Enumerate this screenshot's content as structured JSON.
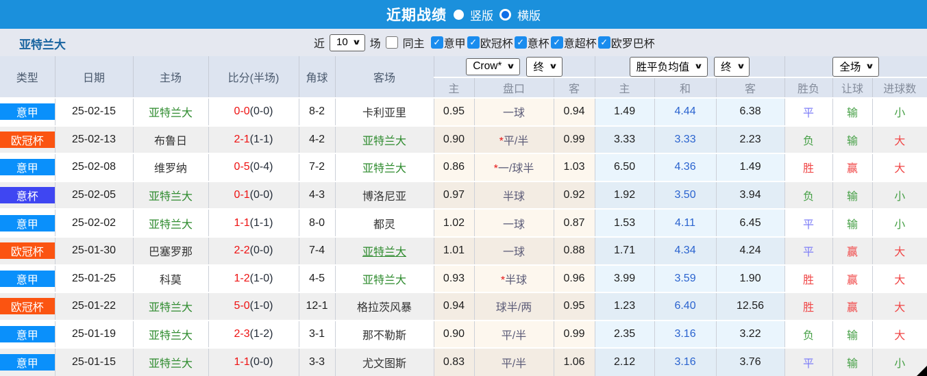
{
  "title_bar": {
    "title": "近期战绩",
    "view_options": [
      {
        "label": "竖版",
        "selected": true
      },
      {
        "label": "横版",
        "selected": false
      }
    ]
  },
  "filter_bar": {
    "team": "亚特兰大",
    "near_label": "近",
    "count_value": "10",
    "unit_label": "场",
    "same_home": {
      "label": "同主",
      "checked": false
    },
    "check_glyph": "✓",
    "leagues": [
      {
        "label": "意甲",
        "checked": true
      },
      {
        "label": "欧冠杯",
        "checked": true
      },
      {
        "label": "意杯",
        "checked": true
      },
      {
        "label": "意超杯",
        "checked": true
      },
      {
        "label": "欧罗巴杯",
        "checked": true
      }
    ]
  },
  "table": {
    "main_headers": [
      "类型",
      "日期",
      "主场",
      "比分(半场)",
      "角球",
      "客场"
    ],
    "dropdowns": {
      "crow": "Crow*",
      "crow_final": "终",
      "avg": "胜平负均值",
      "avg_final": "终",
      "scope": "全场"
    },
    "sub_headers": [
      "主",
      "盘口",
      "客",
      "主",
      "和",
      "客",
      "胜负",
      "让球",
      "进球数"
    ],
    "league_colors": {
      "意甲": "#0a90fb",
      "欧冠杯": "#fb5411",
      "意杯": "#3f46f2"
    },
    "accent_colors": {
      "win_red": "#f04646",
      "draw_blue": "#7d7df7",
      "lose_green": "#47a047",
      "bar_blue": "#1b90dc"
    },
    "rows": [
      {
        "league": "意甲",
        "date": "25-02-15",
        "home": "亚特兰大",
        "home_style": "green",
        "ft": "0-0",
        "ht": "(0-0)",
        "corner": "8-2",
        "away": "卡利亚里",
        "away_style": "dark",
        "away_underline": false,
        "crow_home": "0.95",
        "star": false,
        "handicap": "一球",
        "crow_away": "0.94",
        "avg_home": "1.49",
        "avg_draw": "4.44",
        "avg_away": "6.38",
        "outcome": "平",
        "outcome_cls": "draw",
        "let_outcome": "输",
        "let_cls": "lose",
        "goal_outcome": "小",
        "goal_cls": "lose"
      },
      {
        "league": "欧冠杯",
        "date": "25-02-13",
        "home": "布鲁日",
        "home_style": "dark",
        "ft": "2-1",
        "ht": "(1-1)",
        "corner": "4-2",
        "away": "亚特兰大",
        "away_style": "green",
        "away_underline": false,
        "crow_home": "0.90",
        "star": true,
        "handicap": "平/半",
        "crow_away": "0.99",
        "avg_home": "3.33",
        "avg_draw": "3.33",
        "avg_away": "2.23",
        "outcome": "负",
        "outcome_cls": "lose",
        "let_outcome": "输",
        "let_cls": "lose",
        "goal_outcome": "大",
        "goal_cls": "win"
      },
      {
        "league": "意甲",
        "date": "25-02-08",
        "home": "维罗纳",
        "home_style": "dark",
        "ft": "0-5",
        "ht": "(0-4)",
        "corner": "7-2",
        "away": "亚特兰大",
        "away_style": "green",
        "away_underline": false,
        "crow_home": "0.86",
        "star": true,
        "handicap": "一/球半",
        "crow_away": "1.03",
        "avg_home": "6.50",
        "avg_draw": "4.36",
        "avg_away": "1.49",
        "outcome": "胜",
        "outcome_cls": "win",
        "let_outcome": "赢",
        "let_cls": "win",
        "goal_outcome": "大",
        "goal_cls": "win"
      },
      {
        "league": "意杯",
        "date": "25-02-05",
        "home": "亚特兰大",
        "home_style": "green",
        "ft": "0-1",
        "ht": "(0-0)",
        "corner": "4-3",
        "away": "博洛尼亚",
        "away_style": "dark",
        "away_underline": false,
        "crow_home": "0.97",
        "star": false,
        "handicap": "半球",
        "crow_away": "0.92",
        "avg_home": "1.92",
        "avg_draw": "3.50",
        "avg_away": "3.94",
        "outcome": "负",
        "outcome_cls": "lose",
        "let_outcome": "输",
        "let_cls": "lose",
        "goal_outcome": "小",
        "goal_cls": "lose"
      },
      {
        "league": "意甲",
        "date": "25-02-02",
        "home": "亚特兰大",
        "home_style": "green",
        "ft": "1-1",
        "ht": "(1-1)",
        "corner": "8-0",
        "away": "都灵",
        "away_style": "dark",
        "away_underline": false,
        "crow_home": "1.02",
        "star": false,
        "handicap": "一球",
        "crow_away": "0.87",
        "avg_home": "1.53",
        "avg_draw": "4.11",
        "avg_away": "6.45",
        "outcome": "平",
        "outcome_cls": "draw",
        "let_outcome": "输",
        "let_cls": "lose",
        "goal_outcome": "小",
        "goal_cls": "lose"
      },
      {
        "league": "欧冠杯",
        "date": "25-01-30",
        "home": "巴塞罗那",
        "home_style": "dark",
        "ft": "2-2",
        "ht": "(0-0)",
        "corner": "7-4",
        "away": "亚特兰大",
        "away_style": "green",
        "away_underline": true,
        "crow_home": "1.01",
        "star": false,
        "handicap": "一球",
        "crow_away": "0.88",
        "avg_home": "1.71",
        "avg_draw": "4.34",
        "avg_away": "4.24",
        "outcome": "平",
        "outcome_cls": "draw",
        "let_outcome": "赢",
        "let_cls": "win",
        "goal_outcome": "大",
        "goal_cls": "win"
      },
      {
        "league": "意甲",
        "date": "25-01-25",
        "home": "科莫",
        "home_style": "dark",
        "ft": "1-2",
        "ht": "(1-0)",
        "corner": "4-5",
        "away": "亚特兰大",
        "away_style": "green",
        "away_underline": false,
        "crow_home": "0.93",
        "star": true,
        "handicap": "半球",
        "crow_away": "0.96",
        "avg_home": "3.99",
        "avg_draw": "3.59",
        "avg_away": "1.90",
        "outcome": "胜",
        "outcome_cls": "win",
        "let_outcome": "赢",
        "let_cls": "win",
        "goal_outcome": "大",
        "goal_cls": "win"
      },
      {
        "league": "欧冠杯",
        "date": "25-01-22",
        "home": "亚特兰大",
        "home_style": "green",
        "ft": "5-0",
        "ht": "(1-0)",
        "corner": "12-1",
        "away": "格拉茨风暴",
        "away_style": "dark",
        "away_underline": false,
        "crow_home": "0.94",
        "star": false,
        "handicap": "球半/两",
        "crow_away": "0.95",
        "avg_home": "1.23",
        "avg_draw": "6.40",
        "avg_away": "12.56",
        "outcome": "胜",
        "outcome_cls": "win",
        "let_outcome": "赢",
        "let_cls": "win",
        "goal_outcome": "大",
        "goal_cls": "win"
      },
      {
        "league": "意甲",
        "date": "25-01-19",
        "home": "亚特兰大",
        "home_style": "green",
        "ft": "2-3",
        "ht": "(1-2)",
        "corner": "3-1",
        "away": "那不勒斯",
        "away_style": "dark",
        "away_underline": false,
        "crow_home": "0.90",
        "star": false,
        "handicap": "平/半",
        "crow_away": "0.99",
        "avg_home": "2.35",
        "avg_draw": "3.16",
        "avg_away": "3.22",
        "outcome": "负",
        "outcome_cls": "lose",
        "let_outcome": "输",
        "let_cls": "lose",
        "goal_outcome": "大",
        "goal_cls": "win"
      },
      {
        "league": "意甲",
        "date": "25-01-15",
        "home": "亚特兰大",
        "home_style": "green",
        "ft": "1-1",
        "ht": "(0-0)",
        "corner": "3-3",
        "away": "尤文图斯",
        "away_style": "dark",
        "away_underline": false,
        "crow_home": "0.83",
        "star": false,
        "handicap": "平/半",
        "crow_away": "1.06",
        "avg_home": "2.12",
        "avg_draw": "3.16",
        "avg_away": "3.76",
        "outcome": "平",
        "outcome_cls": "draw",
        "let_outcome": "输",
        "let_cls": "lose",
        "goal_outcome": "小",
        "goal_cls": "lose"
      }
    ]
  }
}
